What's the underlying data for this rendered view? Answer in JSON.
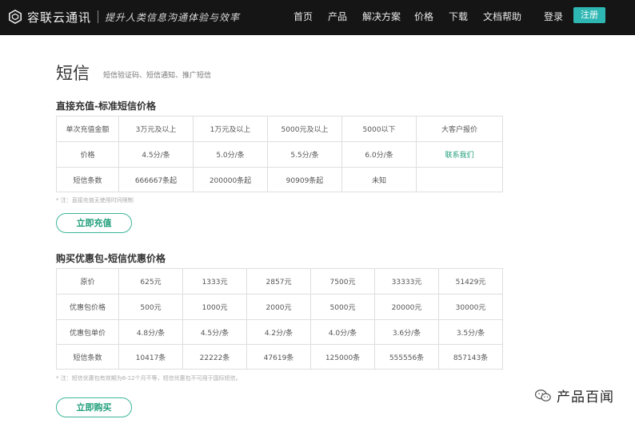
{
  "header": {
    "brand": "容联云通讯",
    "slogan": "提升人类信息沟通体验与效率",
    "nav": [
      "首页",
      "产品",
      "解决方案",
      "价格",
      "下载",
      "文档帮助"
    ],
    "login": "登录",
    "register": "注册",
    "accent_color": "#2db6b2"
  },
  "page": {
    "title": "短信",
    "subtitle": "短信验证码、短信通知、推广短信"
  },
  "direct": {
    "title": "直接充值-标准短信价格",
    "rows": [
      [
        "单次充值金额",
        "3万元及以上",
        "1万元及以上",
        "5000元及以上",
        "5000以下",
        "大客户报价"
      ],
      [
        "价格",
        "4.5分/条",
        "5.0分/条",
        "5.5分/条",
        "6.0分/条",
        "联系我们"
      ],
      [
        "短信条数",
        "666667条起",
        "200000条起",
        "90909条起",
        "未知",
        ""
      ]
    ],
    "note": "* 注：直接充值无使用时间限制",
    "button": "立即充值"
  },
  "package": {
    "title": "购买优惠包-短信优惠价格",
    "rows": [
      [
        "原价",
        "625元",
        "1333元",
        "2857元",
        "7500元",
        "33333元",
        "51429元"
      ],
      [
        "优惠包价格",
        "500元",
        "1000元",
        "2000元",
        "5000元",
        "20000元",
        "30000元"
      ],
      [
        "优惠包单价",
        "4.8分/条",
        "4.5分/条",
        "4.2分/条",
        "4.0分/条",
        "3.6分/条",
        "3.5分/条"
      ],
      [
        "短信条数",
        "10417条",
        "22222条",
        "47619条",
        "125000条",
        "555556条",
        "857143条"
      ]
    ],
    "note": "* 注：短信优惠包有效期为6-12个月不等，短信优惠包不可用于国际短信。",
    "button": "立即购买"
  },
  "watermark": {
    "text": "产品百闻",
    "icon": "wechat-icon"
  }
}
